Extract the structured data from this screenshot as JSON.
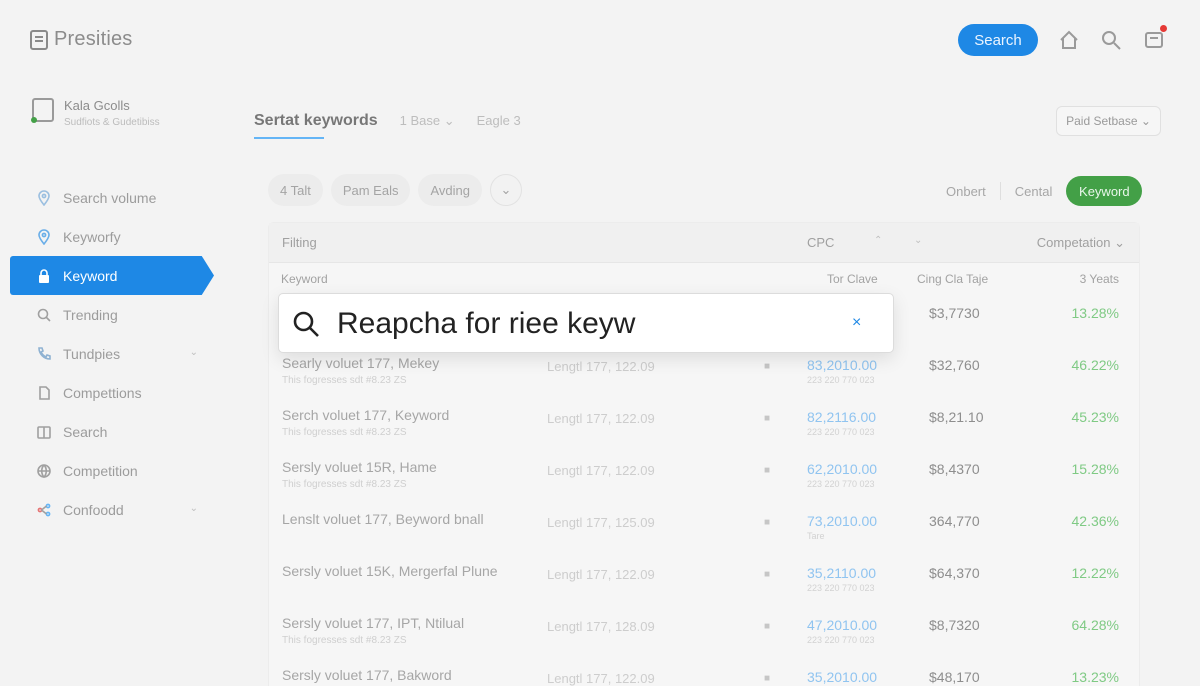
{
  "app": {
    "brand": "Presities",
    "search_button": "Search"
  },
  "colors": {
    "primary": "#1e88e5",
    "success": "#43a047",
    "notification": "#e53935"
  },
  "account": {
    "name": "Kala Gcolls",
    "subtitle": "Sudfiots & Gudetibiss"
  },
  "sidebar": {
    "items": [
      {
        "label": "Search volume",
        "icon": "location-pin-icon",
        "active": false
      },
      {
        "label": "Keyworfy",
        "icon": "location-pin-icon",
        "active": false
      },
      {
        "label": "Keyword",
        "icon": "lock-icon",
        "active": true
      },
      {
        "label": "Trending",
        "icon": "search-icon",
        "active": false
      },
      {
        "label": "Tundpies",
        "icon": "phone-icon",
        "active": false,
        "chevron": "⌄"
      },
      {
        "label": "Compettions",
        "icon": "document-icon",
        "active": false
      },
      {
        "label": "Search",
        "icon": "book-icon",
        "active": false
      },
      {
        "label": "Competition",
        "icon": "globe-icon",
        "active": false
      },
      {
        "label": "Confoodd",
        "icon": "branch-icon",
        "active": false,
        "chevron": "⌄"
      }
    ]
  },
  "main": {
    "title": "Sertat keywords",
    "meta1": "1 Base ⌄",
    "meta2": "Eagle 3",
    "database_select": "Paid Setbase ⌄",
    "filter_chips": [
      "4 Talt",
      "Pam Eals",
      "Avding"
    ],
    "view_toggle": [
      "Onbert",
      "Cental",
      "Keyword"
    ],
    "table": {
      "filter_label": "Filting",
      "cpc_label": "CPC",
      "sort1": "⌃",
      "sort2": "⌄",
      "competition_label": "Competation ⌄",
      "columns": {
        "keyword": "Keyword",
        "total": "Tor Clave",
        "comp": "Cing Cla Taje",
        "year": "3 Yeats"
      },
      "rows": [
        {
          "keyword": "",
          "sub": "",
          "length": "",
          "value": "",
          "valsub": "",
          "num": "$3,7730",
          "pct": "13.28%"
        },
        {
          "keyword": "Searly voluet 177, Mekey",
          "sub": "This fogresses sdt #8.23 ZS",
          "length": "Lengtl 177, 122.09",
          "value": "83,2010.00",
          "valsub": "223 220 770 023",
          "num": "$32,760",
          "pct": "46.22%"
        },
        {
          "keyword": "Serch voluet 177, Keyword",
          "sub": "This fogresses sdt #8.23 ZS",
          "length": "Lengtl 177, 122.09",
          "value": "82,2116.00",
          "valsub": "223 220 770 023",
          "num": "$8,21.10",
          "pct": "45.23%"
        },
        {
          "keyword": "Sersly voluet 15R, Hame",
          "sub": "This fogresses sdt #8.23 ZS",
          "length": "Lengtl 177, 122.09",
          "value": "62,2010.00",
          "valsub": "223 220 770 023",
          "num": "$8,4370",
          "pct": "15.28%"
        },
        {
          "keyword": "Lenslt voluet 177, Beyword bnall",
          "sub": "",
          "length": "Lengtl 177, 125.09",
          "value": "73,2010.00",
          "valsub": "Tare",
          "num": "364,770",
          "pct": "42.36%"
        },
        {
          "keyword": "Sersly voluet 15K, Mergerfal Plune",
          "sub": "",
          "length": "Lengtl 177, 122.09",
          "value": "35,2110.00",
          "valsub": "223 220 770 023",
          "num": "$64,370",
          "pct": "12.22%"
        },
        {
          "keyword": "Sersly voluet 177, IPT, Ntilual",
          "sub": "This fogresses sdt #8.23 ZS",
          "length": "Lengtl 177, 128.09",
          "value": "47,2010.00",
          "valsub": "223 220 770 023",
          "num": "$8,7320",
          "pct": "64.28%"
        },
        {
          "keyword": "Sersly voluet 177, Bakword",
          "sub": "",
          "length": "Lengtl 177, 122.09",
          "value": "35,2010.00",
          "valsub": "",
          "num": "$48,170",
          "pct": "13.23%"
        }
      ]
    }
  },
  "search_popup": {
    "value": "Reapcha for riee keyw",
    "clear": "×"
  }
}
